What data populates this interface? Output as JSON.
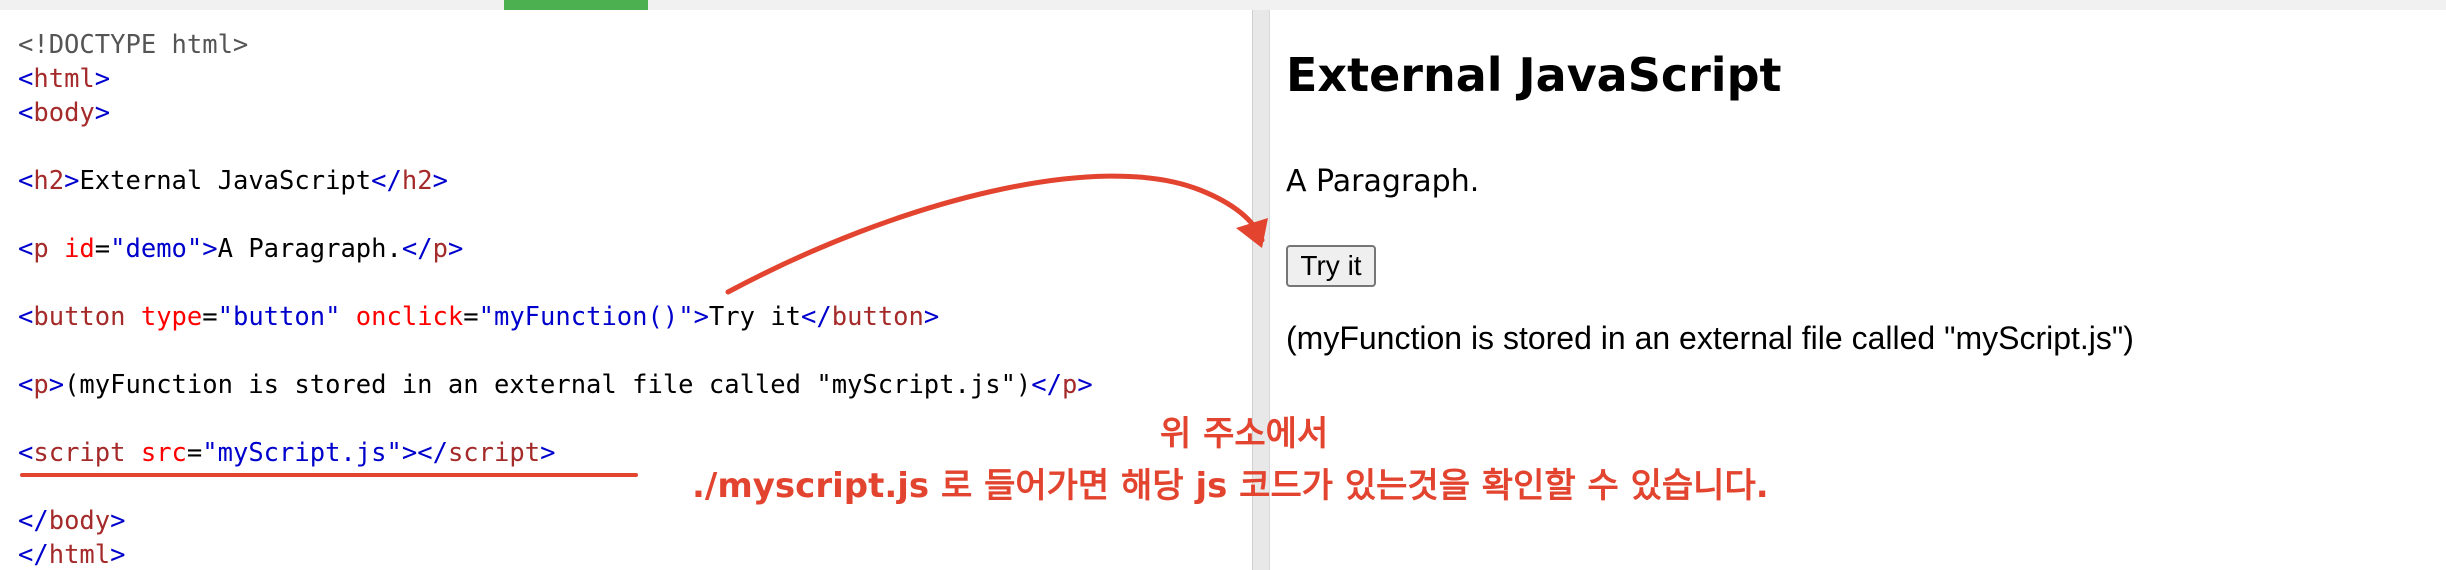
{
  "window": {
    "accent_color": "#4caf50"
  },
  "editor": {
    "lines": [
      [
        {
          "t": "<!DOCTYPE html>",
          "c": "doctype"
        }
      ],
      [
        {
          "t": "<",
          "c": "br"
        },
        {
          "t": "html",
          "c": "tag"
        },
        {
          "t": ">",
          "c": "br"
        }
      ],
      [
        {
          "t": "<",
          "c": "br"
        },
        {
          "t": "body",
          "c": "tag"
        },
        {
          "t": ">",
          "c": "br"
        }
      ],
      [],
      [
        {
          "t": "<",
          "c": "br"
        },
        {
          "t": "h2",
          "c": "tag"
        },
        {
          "t": ">",
          "c": "br"
        },
        {
          "t": "External JavaScript",
          "c": "plain"
        },
        {
          "t": "</",
          "c": "br"
        },
        {
          "t": "h2",
          "c": "tag"
        },
        {
          "t": ">",
          "c": "br"
        }
      ],
      [],
      [
        {
          "t": "<",
          "c": "br"
        },
        {
          "t": "p",
          "c": "tag"
        },
        {
          "t": " id",
          "c": "attr"
        },
        {
          "t": "=",
          "c": "plain"
        },
        {
          "t": "\"demo\"",
          "c": "val"
        },
        {
          "t": ">",
          "c": "br"
        },
        {
          "t": "A Paragraph.",
          "c": "plain"
        },
        {
          "t": "</",
          "c": "br"
        },
        {
          "t": "p",
          "c": "tag"
        },
        {
          "t": ">",
          "c": "br"
        }
      ],
      [],
      [
        {
          "t": "<",
          "c": "br"
        },
        {
          "t": "button",
          "c": "tag"
        },
        {
          "t": " type",
          "c": "attr"
        },
        {
          "t": "=",
          "c": "plain"
        },
        {
          "t": "\"button\"",
          "c": "val"
        },
        {
          "t": " onclick",
          "c": "attr"
        },
        {
          "t": "=",
          "c": "plain"
        },
        {
          "t": "\"myFunction()\"",
          "c": "val"
        },
        {
          "t": ">",
          "c": "br"
        },
        {
          "t": "Try it",
          "c": "plain"
        },
        {
          "t": "</",
          "c": "br"
        },
        {
          "t": "button",
          "c": "tag"
        },
        {
          "t": ">",
          "c": "br"
        }
      ],
      [],
      [
        {
          "t": "<",
          "c": "br"
        },
        {
          "t": "p",
          "c": "tag"
        },
        {
          "t": ">",
          "c": "br"
        },
        {
          "t": "(myFunction is stored in an external file called \"myScript.js\")",
          "c": "plain"
        },
        {
          "t": "</",
          "c": "br"
        },
        {
          "t": "p",
          "c": "tag"
        },
        {
          "t": ">",
          "c": "br"
        }
      ],
      [],
      [
        {
          "t": "<",
          "c": "br"
        },
        {
          "t": "script",
          "c": "tag"
        },
        {
          "t": " src",
          "c": "attr"
        },
        {
          "t": "=",
          "c": "plain"
        },
        {
          "t": "\"myScript.js\"",
          "c": "val"
        },
        {
          "t": ">",
          "c": "br"
        },
        {
          "t": "</",
          "c": "br"
        },
        {
          "t": "script",
          "c": "tag"
        },
        {
          "t": ">",
          "c": "br"
        }
      ],
      [],
      [
        {
          "t": "</",
          "c": "br"
        },
        {
          "t": "body",
          "c": "tag"
        },
        {
          "t": ">",
          "c": "br"
        }
      ],
      [
        {
          "t": "</",
          "c": "br"
        },
        {
          "t": "html",
          "c": "tag"
        },
        {
          "t": ">",
          "c": "br"
        }
      ]
    ],
    "syntax_colors": {
      "tag": "#a52a2a",
      "bracket": "#0000cd",
      "attribute": "#ff0000",
      "value": "#0000cd",
      "text": "#000000"
    }
  },
  "preview": {
    "heading": "External JavaScript",
    "paragraph": "A Paragraph.",
    "button_label": "Try it",
    "note": "(myFunction is stored in an external file called \"myScript.js\")"
  },
  "annotation": {
    "line1": "위 주소에서",
    "line2": "./myscript.js 로 들어가면 해당 js 코드가 있는것을 확인할 수 있습니다.",
    "color": "#e2442f"
  }
}
